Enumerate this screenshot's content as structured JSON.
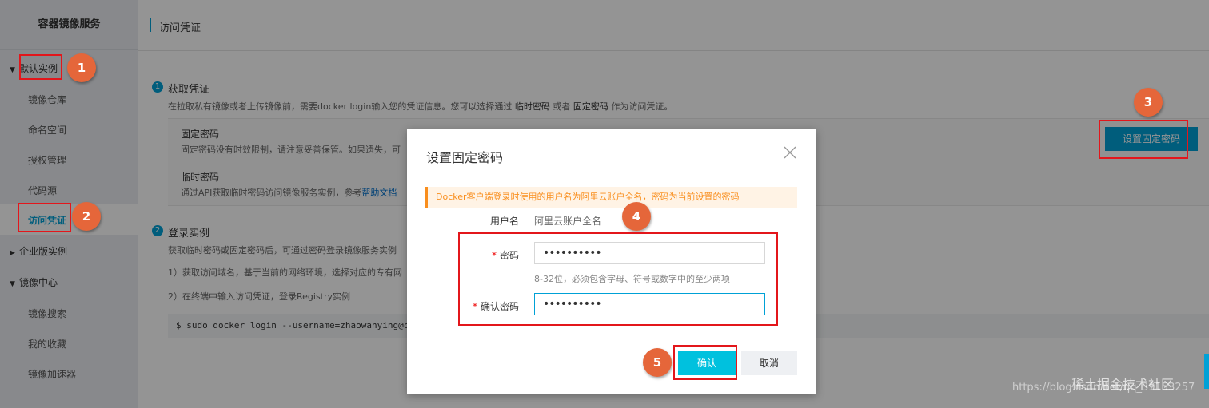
{
  "sidebar": {
    "title": "容器镜像服务",
    "group_default": "默认实例",
    "items": [
      "镜像仓库",
      "命名空间",
      "授权管理",
      "代码源",
      "访问凭证"
    ],
    "group_enterprise": "企业版实例",
    "group_hub": "镜像中心",
    "hub_items": [
      "镜像搜索",
      "我的收藏",
      "镜像加速器"
    ]
  },
  "header": {
    "title": "访问凭证"
  },
  "section1": {
    "num": "1",
    "title": "获取凭证",
    "desc_prefix": "在拉取私有镜像或者上传镜像前，需要docker login输入您的凭证信息。您可以选择通过",
    "desc_temp": "临时密码",
    "desc_or": "或者",
    "desc_fixed": "固定密码",
    "desc_suffix": "作为访问凭证。",
    "fixed_title": "固定密码",
    "fixed_desc": "固定密码没有时效限制，请注意妥善保管。如果遗失，可",
    "temp_title": "临时密码",
    "temp_desc": "通过API获取临时密码访问镜像服务实例，参考",
    "temp_link": "帮助文档",
    "set_button": "设置固定密码"
  },
  "section2": {
    "num": "2",
    "title": "登录实例",
    "desc": "获取临时密码或固定密码后，可通过密码登录镜像服务实例",
    "step1": "1）获取访问域名，基于当前的网络环境，选择对应的专有网",
    "step2": "2）在终端中输入访问凭证，登录Registry实例",
    "command": "$ sudo docker login --username=zhaowanying@cont"
  },
  "modal": {
    "title": "设置固定密码",
    "notice": "Docker客户端登录时使用的用户名为阿里云账户全名，密码为当前设置的密码",
    "username_label": "用户名",
    "username_value": "阿里云账户全名",
    "password_label": "密码",
    "password_value": "••••••••••",
    "password_hint": "8-32位，必须包含字母、符号或数字中的至少两项",
    "confirm_label": "确认密码",
    "confirm_value": "••••••••••",
    "required_mark": "*",
    "ok_button": "确认",
    "cancel_button": "取消"
  },
  "annotations": [
    "1",
    "2",
    "3",
    "4",
    "5"
  ],
  "watermark": "https://blog.csdn.net/qq_39153257",
  "watermark_logo": "稀土掘金技术社区",
  "colors": {
    "accent": "#00a1d6",
    "annotation": "#e5663a",
    "highlight_border": "#e3161b",
    "notice": "#f98e1d"
  }
}
